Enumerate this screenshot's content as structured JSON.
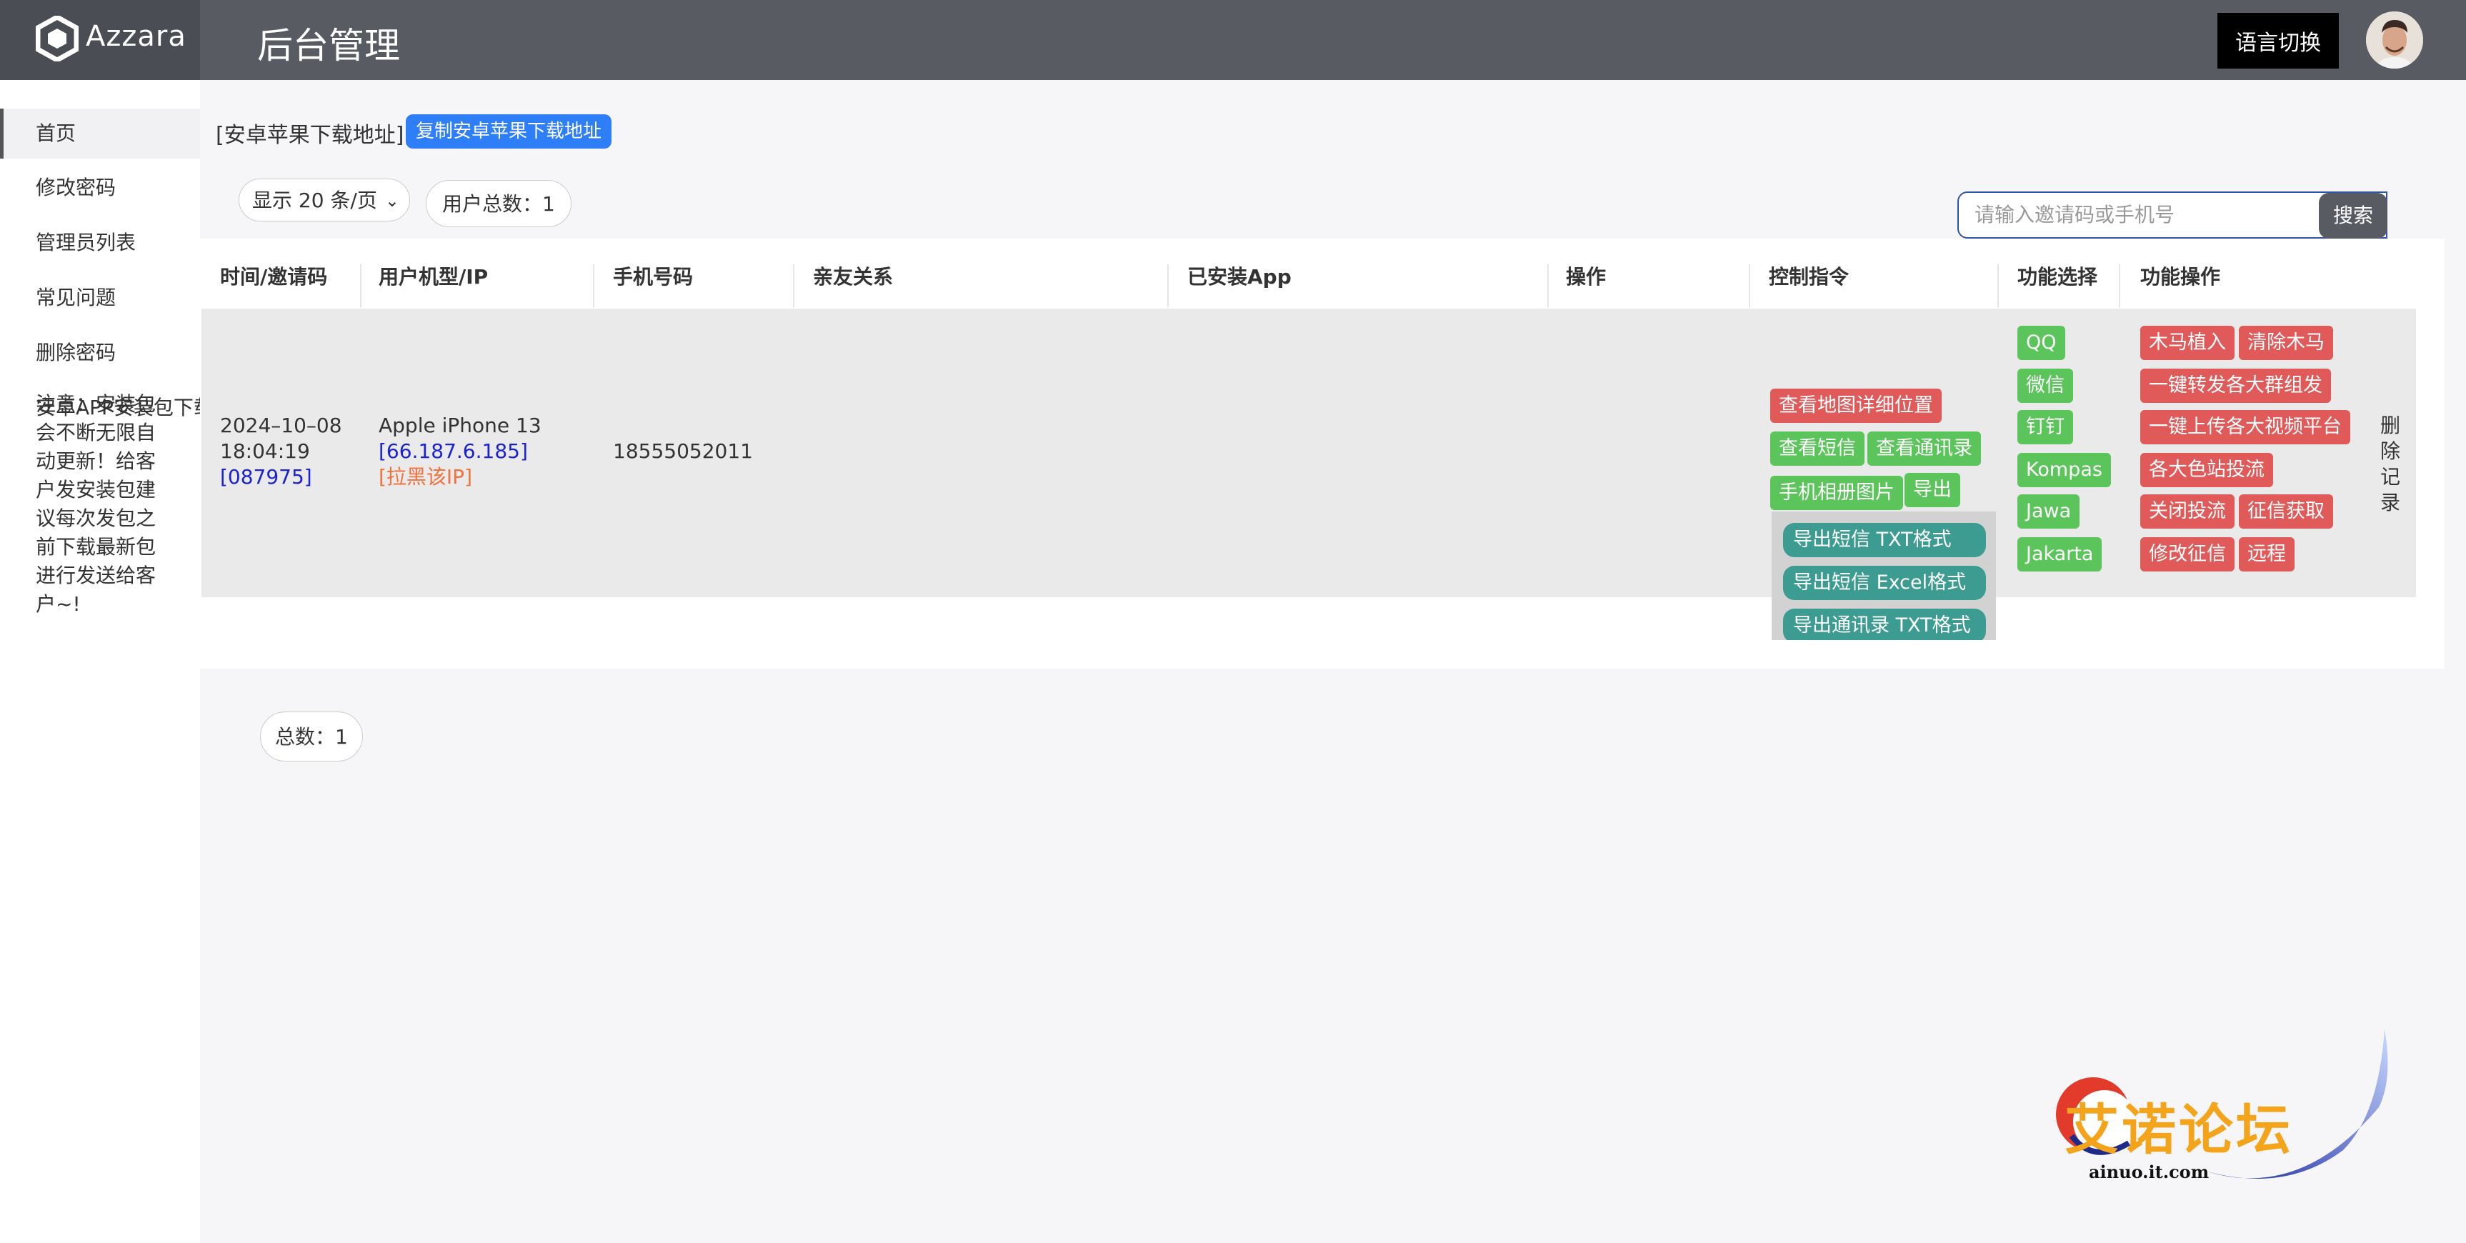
{
  "header": {
    "brand": "Azzara",
    "title": "后台管理",
    "language_button": "语言切换"
  },
  "sidebar": {
    "items": [
      {
        "label": "首页",
        "active": true
      },
      {
        "label": "修改密码"
      },
      {
        "label": "管理员列表"
      },
      {
        "label": "常见问题"
      },
      {
        "label": "删除密码"
      },
      {
        "label": "安卓APP安装包下载"
      }
    ],
    "notice": "注意：安装包会不断无限自动更新！给客户发安装包建议每次发包之前下载最新包进行发送给客户~!"
  },
  "toolbar": {
    "download_label": "[安卓苹果下载地址]",
    "copy_button": "复制安卓苹果下载地址",
    "page_size": "显示 20 条/页",
    "user_total": "用户总数：1",
    "search_placeholder": "请输入邀请码或手机号",
    "search_button": "搜索"
  },
  "table": {
    "headers": [
      "时间/邀请码",
      "用户机型/IP",
      "手机号码",
      "亲友关系",
      "已安装App",
      "操作",
      "控制指令",
      "功能选择",
      "功能操作"
    ],
    "row": {
      "date": "2024–10–08",
      "time": "18:04:19",
      "invite_code": "[087975]",
      "device": "Apple iPhone 13",
      "ip": "[66.187.6.185]",
      "block_ip": "[拉黑该IP]",
      "phone": "18555052011",
      "delete_record": "删除记录"
    },
    "control_commands": [
      "查看地图详细位置",
      "查看短信",
      "查看通讯录",
      "手机相册图片",
      "导出"
    ],
    "export_menu": [
      "导出短信 TXT格式",
      "导出短信 Excel格式",
      "导出通讯录 TXT格式"
    ],
    "feature_select": [
      "QQ",
      "微信",
      "钉钉",
      "Kompas",
      "Jawa",
      "Jakarta"
    ],
    "feature_ops": [
      "木马植入",
      "清除木马",
      "一键转发各大群组发",
      "一键上传各大视频平台",
      "各大色站投流",
      "关闭投流",
      "征信获取",
      "修改征信",
      "远程"
    ]
  },
  "footer": {
    "total": "总数：1"
  },
  "watermark": {
    "text": "艾诺论坛",
    "url": "ainuo.it.com"
  },
  "colors": {
    "header_bg": "#595b62",
    "brand_bg": "#4b4d55",
    "primary_blue": "#2d7ef7",
    "danger_red": "#e05a5a",
    "success_green": "#5bc45b",
    "teal": "#3d9c91"
  }
}
